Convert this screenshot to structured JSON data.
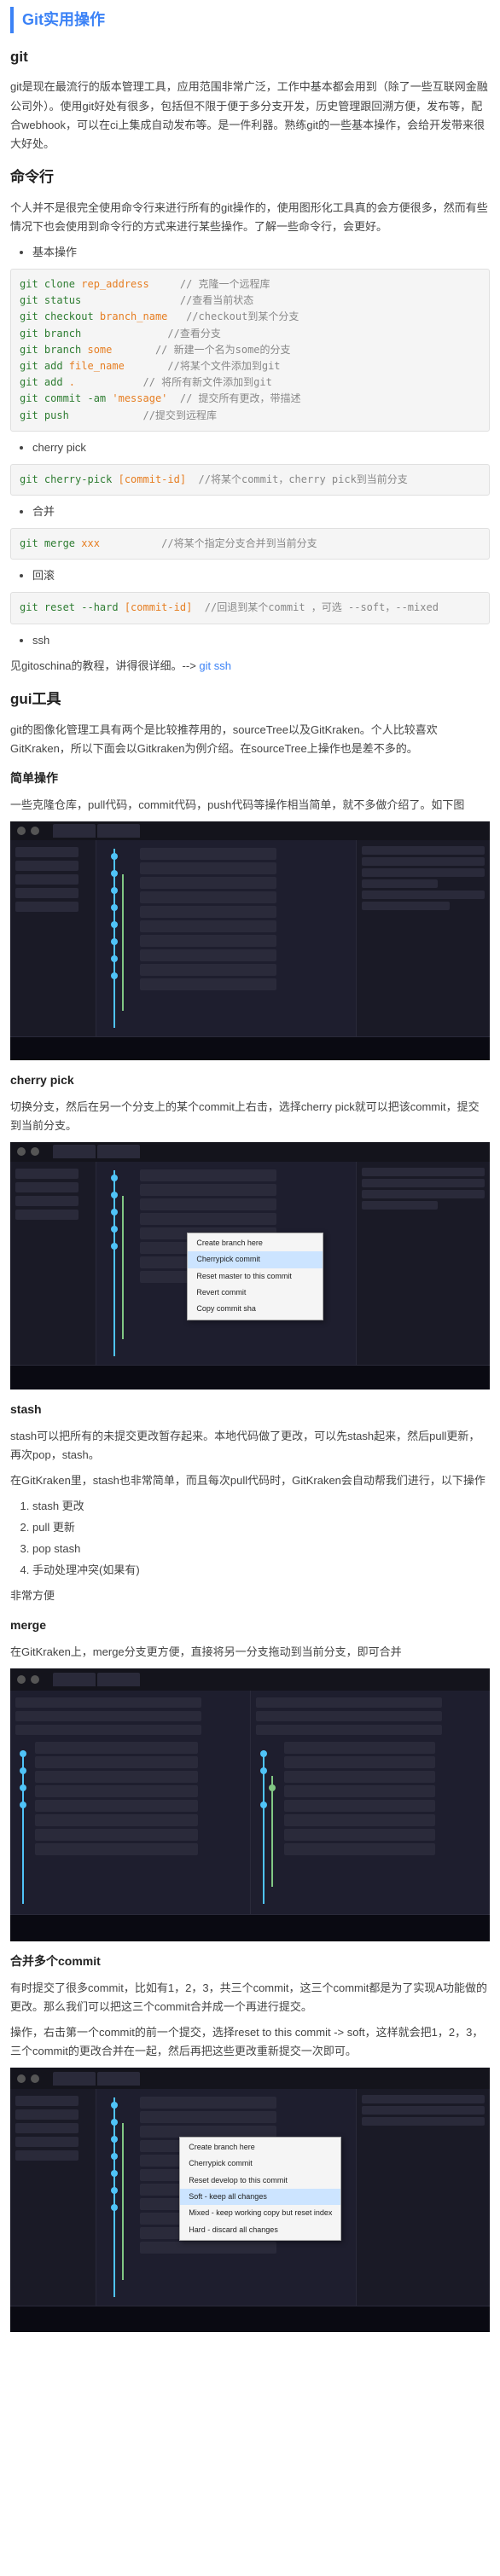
{
  "title": "Git实用操作",
  "sections": {
    "git": {
      "heading": "git",
      "p1": "git是现在最流行的版本管理工具，应用范围非常广泛，工作中基本都会用到（除了一些互联网金融公司外）。使用git好处有很多，包括但不限于便于多分支开发，历史管理跟回溯方便，发布等，配合webhook，可以在ci上集成自动发布等。是一件利器。熟练git的一些基本操作，会给开发带来很大好处。"
    },
    "cli": {
      "heading": "命令行",
      "p1": "个人并不是很完全使用命令行来进行所有的git操作的，使用图形化工具真的会方便很多，然而有些情况下也会使用到命令行的方式来进行某些操作。了解一些命令行，会更好。",
      "items": {
        "basic": {
          "label": "基本操作"
        },
        "cherry": {
          "label": "cherry pick"
        },
        "merge": {
          "label": "合并"
        },
        "reset": {
          "label": "回滚"
        },
        "ssh": {
          "label": "ssh",
          "text": "见gitoschina的教程，讲得很详细。--> ",
          "link": "git ssh"
        }
      },
      "code": {
        "basic": [
          {
            "cmd": "git clone",
            "arg": " rep_address",
            "comment": "     // 克隆一个远程库"
          },
          {
            "cmd": "git status",
            "arg": "",
            "comment": "                //查看当前状态"
          },
          {
            "cmd": "git checkout",
            "arg": " branch_name",
            "comment": "   //checkout到某个分支"
          },
          {
            "cmd": "git branch",
            "arg": "",
            "comment": "              //查看分支"
          },
          {
            "cmd": "git branch",
            "arg": " some",
            "comment": "       // 新建一个名为some的分支"
          },
          {
            "cmd": "git add",
            "arg": " file_name",
            "comment": "       //将某个文件添加到git"
          },
          {
            "cmd": "git add",
            "arg": " .",
            "comment": "           // 将所有新文件添加到git"
          },
          {
            "cmd": "git commit -am",
            "arg": " 'message'",
            "comment": "  // 提交所有更改，带描述"
          },
          {
            "cmd": "git push",
            "arg": "",
            "comment": "            //提交到远程库"
          }
        ],
        "cherry": {
          "cmd": "git cherry-pick",
          "arg": " [commit-id]",
          "comment": "  //将某个commit，cherry pick到当前分支"
        },
        "merge": {
          "cmd": "git merge",
          "arg": " xxx",
          "comment": "          //将某个指定分支合并到当前分支"
        },
        "reset": {
          "cmd": "git reset --hard",
          "arg": " [commit-id]",
          "comment": "  //回退到某个commit ，可选 --soft，--mixed"
        }
      }
    },
    "gui": {
      "heading": "gui工具",
      "p1": "git的图像化管理工具有两个是比较推荐用的，sourceTree以及GitKraken。个人比较喜欢GitKraken，所以下面会以Gitkraken为例介绍。在sourceTree上操作也是差不多的。"
    },
    "simple": {
      "heading": "简单操作",
      "p1": "一些克隆仓库，pull代码，commit代码，push代码等操作相当简单，就不多做介绍了。如下图"
    },
    "cherrypick": {
      "heading": "cherry pick",
      "p1": "切换分支，然后在另一个分支上的某个commit上右击，选择cherry pick就可以把该commit，提交到当前分支。"
    },
    "stash": {
      "heading": "stash",
      "p1": "stash可以把所有的未提交更改暂存起来。本地代码做了更改，可以先stash起来，然后pull更新，再次pop，stash。",
      "p2": "在GitKraken里，stash也非常简单，而且每次pull代码时，GitKraken会自动帮我们进行，以下操作",
      "steps": {
        "s1": "stash 更改",
        "s2": "pull 更新",
        "s3": "pop stash",
        "s4": "手动处理冲突(如果有)"
      },
      "p3": "非常方便"
    },
    "merge": {
      "heading": "merge",
      "p1": "在GitKraken上，merge分支更方便，直接将另一分支拖动到当前分支，即可合并"
    },
    "multi": {
      "heading": "合并多个commit",
      "p1": "有时提交了很多commit，比如有1，2，3，共三个commit，这三个commit都是为了实现A功能做的更改。那么我们可以把这三个commit合并成一个再进行提交。",
      "p2": "操作，右击第一个commit的前一个提交，选择reset to this commit -> soft，这样就会把1，2，3，三个commit的更改合并在一起，然后再把这些更改重新提交一次即可。"
    }
  },
  "menu2": {
    "m1": "Create branch here",
    "m2": "Cherrypick commit",
    "m3": "Reset master to this commit",
    "m4": "Revert commit",
    "m5": "Copy commit sha"
  },
  "menu4": {
    "m1": "Create branch here",
    "m2": "Cherrypick commit",
    "m3": "Reset develop to this commit",
    "m4": "Soft - keep all changes",
    "m5": "Mixed - keep working copy but reset index",
    "m6": "Hard - discard all changes"
  }
}
